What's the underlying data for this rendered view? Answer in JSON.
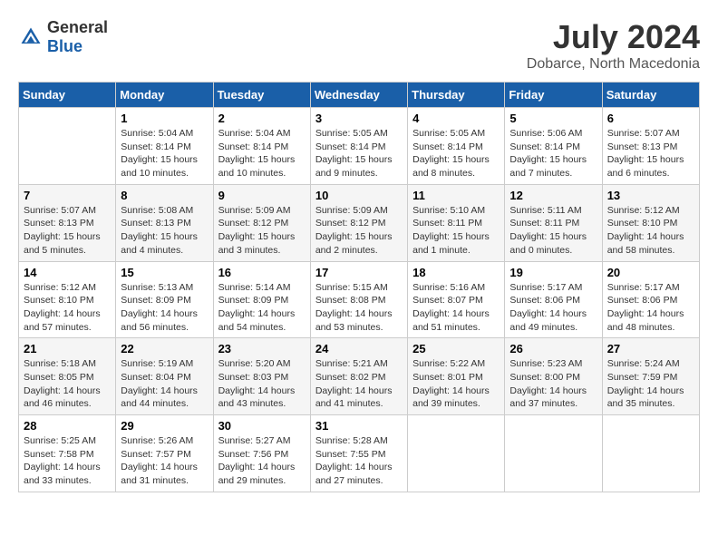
{
  "header": {
    "logo_general": "General",
    "logo_blue": "Blue",
    "month_title": "July 2024",
    "location": "Dobarce, North Macedonia"
  },
  "weekdays": [
    "Sunday",
    "Monday",
    "Tuesday",
    "Wednesday",
    "Thursday",
    "Friday",
    "Saturday"
  ],
  "weeks": [
    [
      {
        "day": "",
        "sunrise": "",
        "sunset": "",
        "daylight": ""
      },
      {
        "day": "1",
        "sunrise": "Sunrise: 5:04 AM",
        "sunset": "Sunset: 8:14 PM",
        "daylight": "Daylight: 15 hours and 10 minutes."
      },
      {
        "day": "2",
        "sunrise": "Sunrise: 5:04 AM",
        "sunset": "Sunset: 8:14 PM",
        "daylight": "Daylight: 15 hours and 10 minutes."
      },
      {
        "day": "3",
        "sunrise": "Sunrise: 5:05 AM",
        "sunset": "Sunset: 8:14 PM",
        "daylight": "Daylight: 15 hours and 9 minutes."
      },
      {
        "day": "4",
        "sunrise": "Sunrise: 5:05 AM",
        "sunset": "Sunset: 8:14 PM",
        "daylight": "Daylight: 15 hours and 8 minutes."
      },
      {
        "day": "5",
        "sunrise": "Sunrise: 5:06 AM",
        "sunset": "Sunset: 8:14 PM",
        "daylight": "Daylight: 15 hours and 7 minutes."
      },
      {
        "day": "6",
        "sunrise": "Sunrise: 5:07 AM",
        "sunset": "Sunset: 8:13 PM",
        "daylight": "Daylight: 15 hours and 6 minutes."
      }
    ],
    [
      {
        "day": "7",
        "sunrise": "Sunrise: 5:07 AM",
        "sunset": "Sunset: 8:13 PM",
        "daylight": "Daylight: 15 hours and 5 minutes."
      },
      {
        "day": "8",
        "sunrise": "Sunrise: 5:08 AM",
        "sunset": "Sunset: 8:13 PM",
        "daylight": "Daylight: 15 hours and 4 minutes."
      },
      {
        "day": "9",
        "sunrise": "Sunrise: 5:09 AM",
        "sunset": "Sunset: 8:12 PM",
        "daylight": "Daylight: 15 hours and 3 minutes."
      },
      {
        "day": "10",
        "sunrise": "Sunrise: 5:09 AM",
        "sunset": "Sunset: 8:12 PM",
        "daylight": "Daylight: 15 hours and 2 minutes."
      },
      {
        "day": "11",
        "sunrise": "Sunrise: 5:10 AM",
        "sunset": "Sunset: 8:11 PM",
        "daylight": "Daylight: 15 hours and 1 minute."
      },
      {
        "day": "12",
        "sunrise": "Sunrise: 5:11 AM",
        "sunset": "Sunset: 8:11 PM",
        "daylight": "Daylight: 15 hours and 0 minutes."
      },
      {
        "day": "13",
        "sunrise": "Sunrise: 5:12 AM",
        "sunset": "Sunset: 8:10 PM",
        "daylight": "Daylight: 14 hours and 58 minutes."
      }
    ],
    [
      {
        "day": "14",
        "sunrise": "Sunrise: 5:12 AM",
        "sunset": "Sunset: 8:10 PM",
        "daylight": "Daylight: 14 hours and 57 minutes."
      },
      {
        "day": "15",
        "sunrise": "Sunrise: 5:13 AM",
        "sunset": "Sunset: 8:09 PM",
        "daylight": "Daylight: 14 hours and 56 minutes."
      },
      {
        "day": "16",
        "sunrise": "Sunrise: 5:14 AM",
        "sunset": "Sunset: 8:09 PM",
        "daylight": "Daylight: 14 hours and 54 minutes."
      },
      {
        "day": "17",
        "sunrise": "Sunrise: 5:15 AM",
        "sunset": "Sunset: 8:08 PM",
        "daylight": "Daylight: 14 hours and 53 minutes."
      },
      {
        "day": "18",
        "sunrise": "Sunrise: 5:16 AM",
        "sunset": "Sunset: 8:07 PM",
        "daylight": "Daylight: 14 hours and 51 minutes."
      },
      {
        "day": "19",
        "sunrise": "Sunrise: 5:17 AM",
        "sunset": "Sunset: 8:06 PM",
        "daylight": "Daylight: 14 hours and 49 minutes."
      },
      {
        "day": "20",
        "sunrise": "Sunrise: 5:17 AM",
        "sunset": "Sunset: 8:06 PM",
        "daylight": "Daylight: 14 hours and 48 minutes."
      }
    ],
    [
      {
        "day": "21",
        "sunrise": "Sunrise: 5:18 AM",
        "sunset": "Sunset: 8:05 PM",
        "daylight": "Daylight: 14 hours and 46 minutes."
      },
      {
        "day": "22",
        "sunrise": "Sunrise: 5:19 AM",
        "sunset": "Sunset: 8:04 PM",
        "daylight": "Daylight: 14 hours and 44 minutes."
      },
      {
        "day": "23",
        "sunrise": "Sunrise: 5:20 AM",
        "sunset": "Sunset: 8:03 PM",
        "daylight": "Daylight: 14 hours and 43 minutes."
      },
      {
        "day": "24",
        "sunrise": "Sunrise: 5:21 AM",
        "sunset": "Sunset: 8:02 PM",
        "daylight": "Daylight: 14 hours and 41 minutes."
      },
      {
        "day": "25",
        "sunrise": "Sunrise: 5:22 AM",
        "sunset": "Sunset: 8:01 PM",
        "daylight": "Daylight: 14 hours and 39 minutes."
      },
      {
        "day": "26",
        "sunrise": "Sunrise: 5:23 AM",
        "sunset": "Sunset: 8:00 PM",
        "daylight": "Daylight: 14 hours and 37 minutes."
      },
      {
        "day": "27",
        "sunrise": "Sunrise: 5:24 AM",
        "sunset": "Sunset: 7:59 PM",
        "daylight": "Daylight: 14 hours and 35 minutes."
      }
    ],
    [
      {
        "day": "28",
        "sunrise": "Sunrise: 5:25 AM",
        "sunset": "Sunset: 7:58 PM",
        "daylight": "Daylight: 14 hours and 33 minutes."
      },
      {
        "day": "29",
        "sunrise": "Sunrise: 5:26 AM",
        "sunset": "Sunset: 7:57 PM",
        "daylight": "Daylight: 14 hours and 31 minutes."
      },
      {
        "day": "30",
        "sunrise": "Sunrise: 5:27 AM",
        "sunset": "Sunset: 7:56 PM",
        "daylight": "Daylight: 14 hours and 29 minutes."
      },
      {
        "day": "31",
        "sunrise": "Sunrise: 5:28 AM",
        "sunset": "Sunset: 7:55 PM",
        "daylight": "Daylight: 14 hours and 27 minutes."
      },
      {
        "day": "",
        "sunrise": "",
        "sunset": "",
        "daylight": ""
      },
      {
        "day": "",
        "sunrise": "",
        "sunset": "",
        "daylight": ""
      },
      {
        "day": "",
        "sunrise": "",
        "sunset": "",
        "daylight": ""
      }
    ]
  ]
}
